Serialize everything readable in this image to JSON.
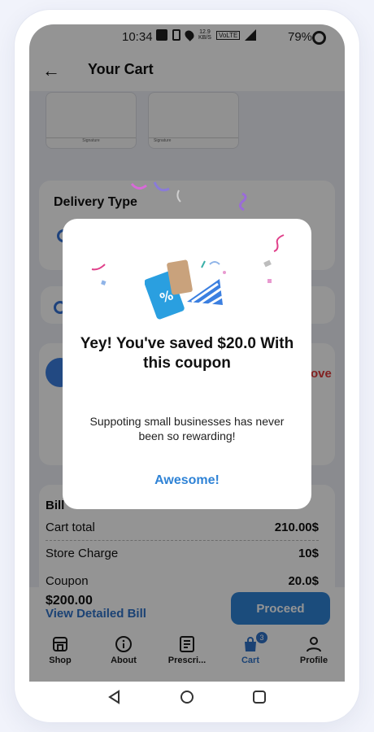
{
  "status_bar": {
    "time": "10:34",
    "data_rate": "12.9",
    "data_unit": "KB/S",
    "network": "VoLTE",
    "battery": "79%"
  },
  "header": {
    "title": "Your Cart"
  },
  "signature": {
    "left_label": "Signature",
    "right_label": "Signature"
  },
  "delivery": {
    "title": "Delivery Type"
  },
  "coupon": {
    "remove_label": "Remove",
    "truncated": "ove"
  },
  "bill": {
    "title": "Bill",
    "rows": [
      {
        "label": "Cart total",
        "value": "210.00$"
      },
      {
        "label": "Store Charge",
        "value": "10$"
      },
      {
        "label": "Coupon",
        "value": "20.0$"
      }
    ]
  },
  "footer": {
    "amount": "$200.00",
    "detail_link": "View Detailed Bill",
    "proceed": "Proceed"
  },
  "tabs": [
    {
      "label": "Shop",
      "icon": "shop-icon"
    },
    {
      "label": "About",
      "icon": "info-icon"
    },
    {
      "label": "Prescri...",
      "icon": "prescription-icon"
    },
    {
      "label": "Cart",
      "icon": "cart-icon",
      "badge": "3",
      "active": true
    },
    {
      "label": "Profile",
      "icon": "profile-icon"
    }
  ],
  "modal": {
    "heading": "Yey! You've saved $20.0 With this coupon",
    "body": "Suppoting small businesses has never been so rewarding!",
    "action": "Awesome!",
    "illustration": "voucher-celebration-icon"
  },
  "colors": {
    "accent": "#2f83d6",
    "danger": "#e03a3a",
    "overlay": "rgba(0,0,0,0.42)"
  }
}
